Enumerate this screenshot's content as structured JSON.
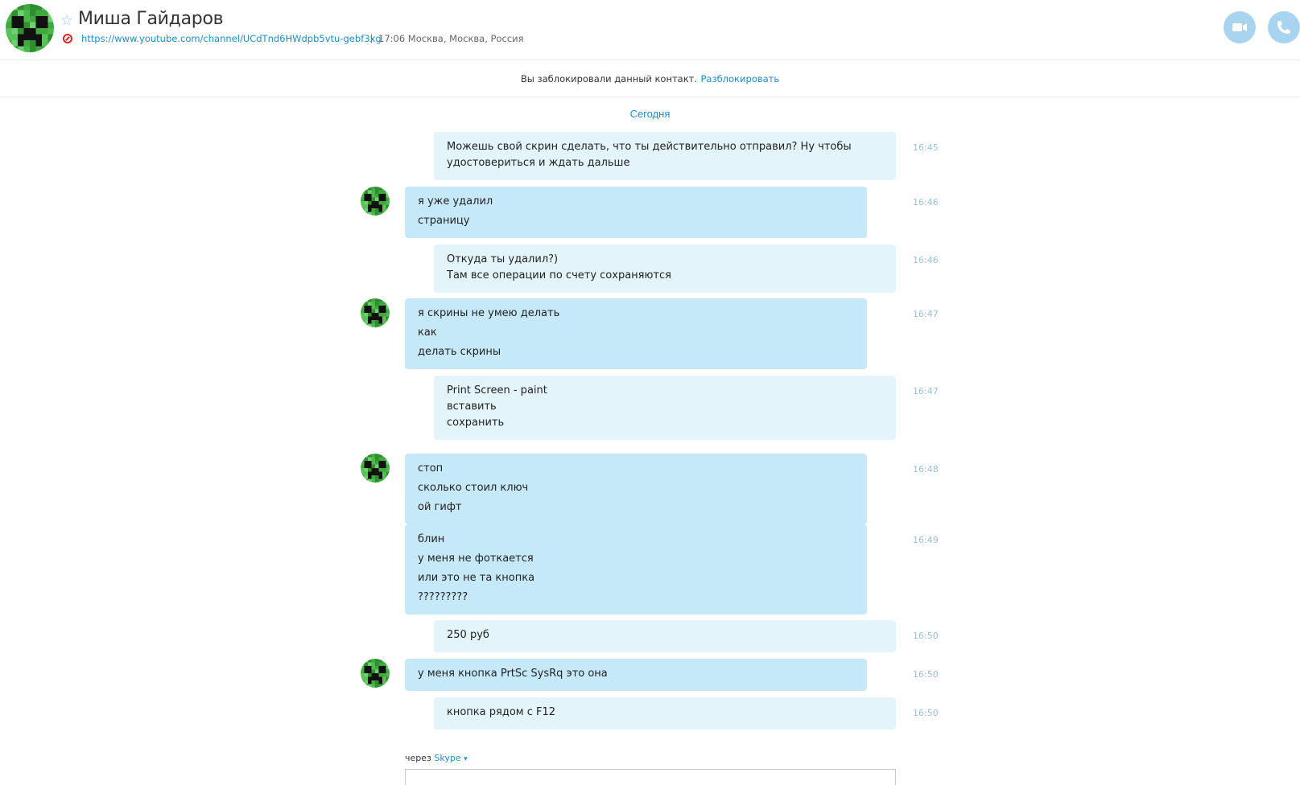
{
  "header": {
    "name": "Миша Гайдаров",
    "mood_link": "https://www.youtube.com/channel/UCdTnd6HWdpb5vtu-gebf3xg",
    "separator": "|",
    "local_info": "17:06 Москва, Москва, Россия",
    "icons": [
      "star-icon",
      "blocked-icon",
      "video-call-icon",
      "phone-call-icon"
    ]
  },
  "notice": {
    "text": "Вы заблокировали данный контакт.",
    "action": "Разблокировать"
  },
  "day_label": "Сегодня",
  "messages": [
    {
      "dir": "out",
      "time": "16:45",
      "lines": [
        "Можешь свой скрин сделать, что ты действительно отправил? Ну чтобы",
        "удостовериться и ждать дальше"
      ]
    },
    {
      "dir": "in",
      "time": "16:46",
      "lines": [
        "я уже удалил",
        "страницу"
      ]
    },
    {
      "dir": "out",
      "time": "16:46",
      "lines": [
        "Откуда ты удалил?)",
        "Там все операции по счету сохраняются"
      ]
    },
    {
      "dir": "in",
      "time": "16:47",
      "lines": [
        "я скрины не умею делать",
        "как",
        "делать скрины"
      ]
    },
    {
      "dir": "out",
      "time": "16:47",
      "lines": [
        "Print Screen - paint",
        "вставить",
        "сохранить"
      ]
    },
    {
      "dir": "in",
      "time": "16:48",
      "lines": [
        "стоп",
        "сколько стоил ключ",
        "ой гифт"
      ]
    },
    {
      "dir": "in",
      "time": "16:49",
      "lines": [
        "блин",
        "у меня не фоткается",
        "или это не та кнопка",
        "?????????"
      ]
    },
    {
      "dir": "out",
      "time": "16:50",
      "lines": [
        "250 руб"
      ]
    },
    {
      "dir": "in",
      "time": "16:50",
      "lines": [
        "у меня кнопка PrtSc SysRq это она"
      ]
    },
    {
      "dir": "out",
      "time": "16:50",
      "lines": [
        "кнопка рядом с F12"
      ]
    }
  ],
  "compose": {
    "via_label": "через",
    "via_service": "Skype",
    "caret": "▾"
  },
  "colors": {
    "accent": "#1b8dcc",
    "bubble_in": "#c6e9f9",
    "bubble_out": "#e3f4fb",
    "call_button": "#a9d4f0",
    "blocked": "#e0242a"
  }
}
